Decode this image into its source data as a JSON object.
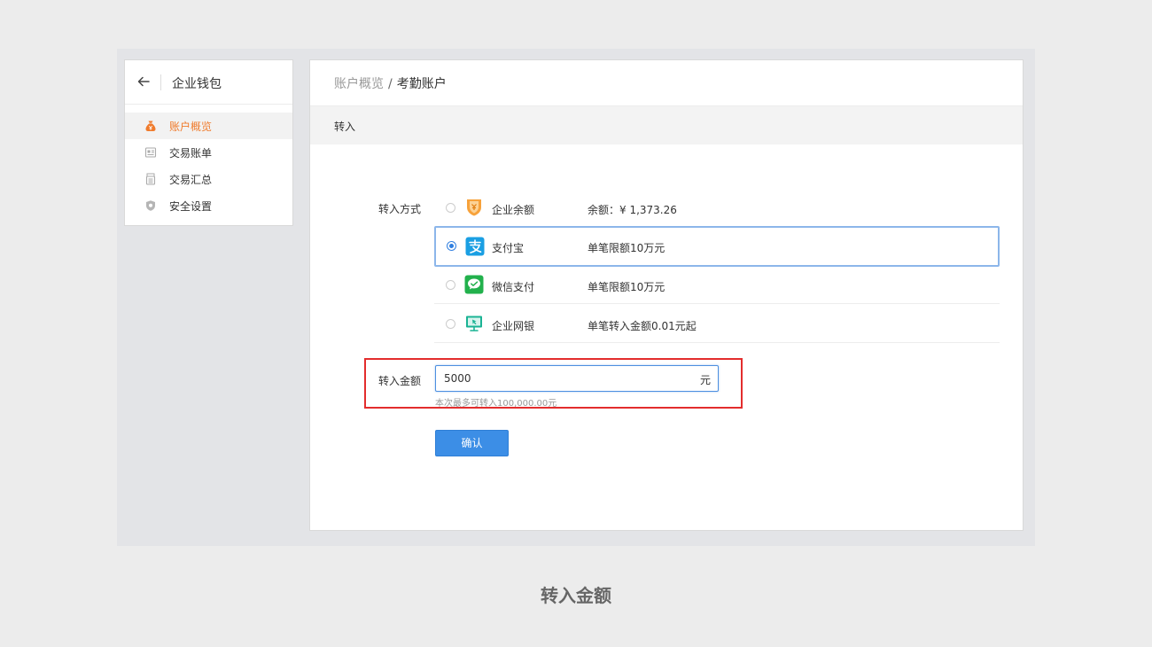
{
  "sidebar": {
    "title": "企业钱包",
    "items": [
      {
        "label": "账户概览",
        "icon": "money-bag-icon",
        "active": true
      },
      {
        "label": "交易账单",
        "icon": "bill-icon",
        "active": false
      },
      {
        "label": "交易汇总",
        "icon": "summary-icon",
        "active": false
      },
      {
        "label": "安全设置",
        "icon": "shield-icon",
        "active": false
      }
    ]
  },
  "breadcrumb": {
    "parent": "账户概览",
    "separator": "/",
    "current": "考勤账户"
  },
  "section": {
    "title": "转入"
  },
  "form": {
    "method_label": "转入方式",
    "methods": [
      {
        "name": "企业余额",
        "desc": "余额：¥ 1,373.26",
        "icon": "enterprise-balance-icon",
        "selected": false
      },
      {
        "name": "支付宝",
        "desc": "单笔限额10万元",
        "icon": "alipay-icon",
        "selected": true
      },
      {
        "name": "微信支付",
        "desc": "单笔限额10万元",
        "icon": "wechat-pay-icon",
        "selected": false
      },
      {
        "name": "企业网银",
        "desc": "单笔转入金额0.01元起",
        "icon": "online-banking-icon",
        "selected": false
      }
    ],
    "amount_label": "转入金额",
    "amount_value": "5000",
    "amount_unit": "元",
    "amount_hint": "本次最多可转入100,000.00元",
    "confirm_label": "确认"
  },
  "caption": "转入金额",
  "colors": {
    "accent": "#3c8ee6",
    "active_menu": "#f07b2c",
    "highlight_box": "#e32d2d",
    "alipay": "#1a9fe3",
    "wechat": "#22b14c",
    "banking": "#1ab394"
  }
}
